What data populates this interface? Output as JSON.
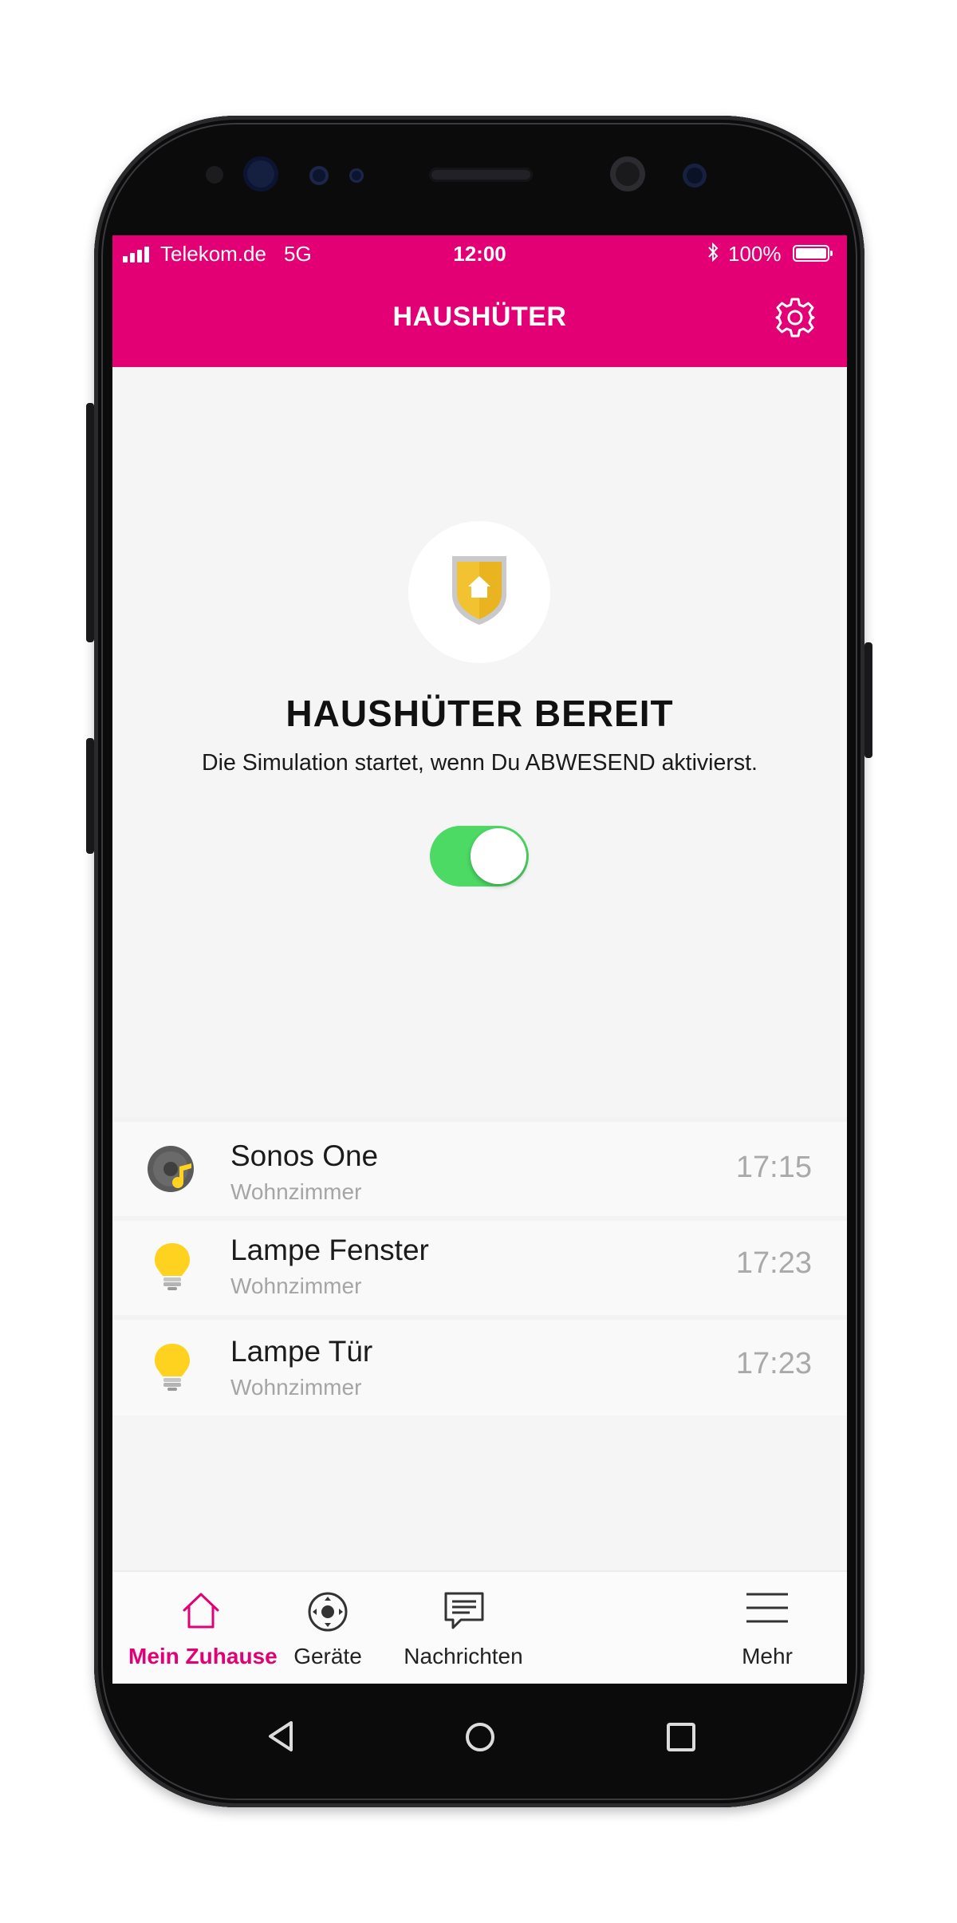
{
  "status_bar": {
    "carrier": "Telekom.de",
    "network": "5G",
    "time": "12:00",
    "battery": "100%",
    "icons": [
      "signal-icon",
      "bluetooth-icon",
      "battery-icon"
    ]
  },
  "header": {
    "title": "HAUSHÜTER",
    "settings_icon": "gear-icon"
  },
  "hero": {
    "icon": "shield-home-icon",
    "title": "HAUSHÜTER BEREIT",
    "subtitle": "Die Simulation startet, wenn Du ABWESEND aktivierst.",
    "toggle_on": true
  },
  "devices": [
    {
      "name": "Sonos One",
      "room": "Wohnzimmer",
      "time": "17:15",
      "icon": "speaker-music-icon"
    },
    {
      "name": "Lampe Fenster",
      "room": "Wohnzimmer",
      "time": "17:23",
      "icon": "light-bulb-icon"
    },
    {
      "name": "Lampe Tür",
      "room": "Wohnzimmer",
      "time": "17:23",
      "icon": "light-bulb-icon"
    }
  ],
  "tabs": [
    {
      "label": "Mein Zuhause",
      "icon": "home-icon",
      "active": true
    },
    {
      "label": "Geräte",
      "icon": "device-control-icon",
      "active": false
    },
    {
      "label": "Nachrichten",
      "icon": "message-icon",
      "active": false
    },
    {
      "label": "Mehr",
      "icon": "menu-icon",
      "active": false
    }
  ],
  "colors": {
    "brand": "#e20074",
    "toggle_on": "#4cd964",
    "shield": "#f2c230",
    "bulb": "#ffd21f"
  }
}
